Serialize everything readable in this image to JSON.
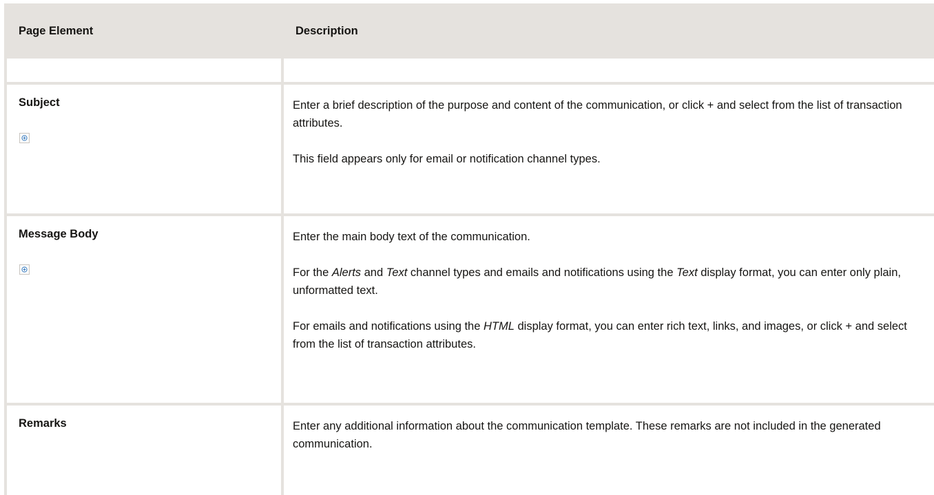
{
  "header": {
    "col1": "Page Element",
    "col2": "Description"
  },
  "rows": {
    "subject": {
      "element": "Subject",
      "icon": "add-attribute-icon",
      "desc_p1": "Enter a brief description of the purpose and content of the communication, or click + and select from the list of transaction attributes.",
      "desc_p2": "This field appears only for email or notification channel types."
    },
    "message_body": {
      "element": "Message Body",
      "icon": "add-attribute-icon",
      "desc_p1": "Enter the main body text of the communication.",
      "desc_p2_a": "For the ",
      "desc_p2_alerts": "Alerts",
      "desc_p2_b": " and ",
      "desc_p2_text1": "Text",
      "desc_p2_c": " channel types and emails and notifications using the ",
      "desc_p2_text2": "Text",
      "desc_p2_d": " display format, you can enter only plain, unformatted text.",
      "desc_p3_a": "For emails and notifications using the ",
      "desc_p3_html": "HTML",
      "desc_p3_b": " display format, you can enter rich text, links, and images, or click + and select from the list of transaction attributes."
    },
    "remarks": {
      "element": "Remarks",
      "desc_p1": "Enter any additional information about the communication template. These remarks are not included in the generated communication."
    }
  },
  "colors": {
    "border": "#e5e2de",
    "header_bg": "#e5e2de",
    "icon_accent": "#3a7dc2"
  }
}
